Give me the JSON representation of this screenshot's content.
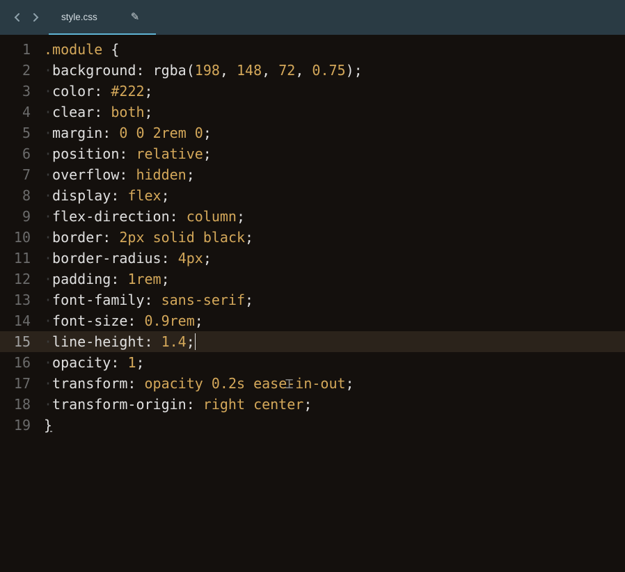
{
  "tab": {
    "filename": "style.css",
    "modified_glyph": "✎"
  },
  "editor": {
    "active_line": 15,
    "text_cursor_line": 17,
    "lines": [
      {
        "n": 1,
        "tokens": [
          {
            "cls": "sel",
            "t": ".module"
          },
          {
            "cls": "brace",
            "t": " {"
          }
        ],
        "indent": 0
      },
      {
        "n": 2,
        "tokens": [
          {
            "cls": "prop",
            "t": "background"
          },
          {
            "cls": "colon",
            "t": ": "
          },
          {
            "cls": "func",
            "t": "rgba("
          },
          {
            "cls": "num",
            "t": "198"
          },
          {
            "cls": "comma",
            "t": ", "
          },
          {
            "cls": "num",
            "t": "148"
          },
          {
            "cls": "comma",
            "t": ", "
          },
          {
            "cls": "num",
            "t": "72"
          },
          {
            "cls": "comma",
            "t": ", "
          },
          {
            "cls": "num",
            "t": "0.75"
          },
          {
            "cls": "func",
            "t": ")"
          },
          {
            "cls": "semi",
            "t": ";"
          }
        ],
        "indent": 1
      },
      {
        "n": 3,
        "tokens": [
          {
            "cls": "prop",
            "t": "color"
          },
          {
            "cls": "colon",
            "t": ": "
          },
          {
            "cls": "hex",
            "t": "#222"
          },
          {
            "cls": "semi",
            "t": ";"
          }
        ],
        "indent": 1
      },
      {
        "n": 4,
        "tokens": [
          {
            "cls": "prop",
            "t": "clear"
          },
          {
            "cls": "colon",
            "t": ": "
          },
          {
            "cls": "kw",
            "t": "both"
          },
          {
            "cls": "semi",
            "t": ";"
          }
        ],
        "indent": 1
      },
      {
        "n": 5,
        "tokens": [
          {
            "cls": "prop",
            "t": "margin"
          },
          {
            "cls": "colon",
            "t": ": "
          },
          {
            "cls": "num",
            "t": "0"
          },
          {
            "cls": "ws",
            "t": " "
          },
          {
            "cls": "num",
            "t": "0"
          },
          {
            "cls": "ws",
            "t": " "
          },
          {
            "cls": "num",
            "t": "2rem"
          },
          {
            "cls": "ws",
            "t": " "
          },
          {
            "cls": "num",
            "t": "0"
          },
          {
            "cls": "semi",
            "t": ";"
          }
        ],
        "indent": 1
      },
      {
        "n": 6,
        "tokens": [
          {
            "cls": "prop",
            "t": "position"
          },
          {
            "cls": "colon",
            "t": ": "
          },
          {
            "cls": "kw",
            "t": "relative"
          },
          {
            "cls": "semi",
            "t": ";"
          }
        ],
        "indent": 1
      },
      {
        "n": 7,
        "tokens": [
          {
            "cls": "prop",
            "t": "overflow"
          },
          {
            "cls": "colon",
            "t": ": "
          },
          {
            "cls": "kw",
            "t": "hidden"
          },
          {
            "cls": "semi",
            "t": ";"
          }
        ],
        "indent": 1
      },
      {
        "n": 8,
        "tokens": [
          {
            "cls": "prop",
            "t": "display"
          },
          {
            "cls": "colon",
            "t": ": "
          },
          {
            "cls": "kw",
            "t": "flex"
          },
          {
            "cls": "semi",
            "t": ";"
          }
        ],
        "indent": 1
      },
      {
        "n": 9,
        "tokens": [
          {
            "cls": "prop",
            "t": "flex-direction"
          },
          {
            "cls": "colon",
            "t": ": "
          },
          {
            "cls": "kw",
            "t": "column"
          },
          {
            "cls": "semi",
            "t": ";"
          }
        ],
        "indent": 1
      },
      {
        "n": 10,
        "tokens": [
          {
            "cls": "prop",
            "t": "border"
          },
          {
            "cls": "colon",
            "t": ": "
          },
          {
            "cls": "num",
            "t": "2px"
          },
          {
            "cls": "ws",
            "t": " "
          },
          {
            "cls": "kw",
            "t": "solid"
          },
          {
            "cls": "ws",
            "t": " "
          },
          {
            "cls": "kw",
            "t": "black"
          },
          {
            "cls": "semi",
            "t": ";"
          }
        ],
        "indent": 1
      },
      {
        "n": 11,
        "tokens": [
          {
            "cls": "prop",
            "t": "border-radius"
          },
          {
            "cls": "colon",
            "t": ": "
          },
          {
            "cls": "num",
            "t": "4px"
          },
          {
            "cls": "semi",
            "t": ";"
          }
        ],
        "indent": 1
      },
      {
        "n": 12,
        "tokens": [
          {
            "cls": "prop",
            "t": "padding"
          },
          {
            "cls": "colon",
            "t": ": "
          },
          {
            "cls": "num",
            "t": "1rem"
          },
          {
            "cls": "semi",
            "t": ";"
          }
        ],
        "indent": 1
      },
      {
        "n": 13,
        "tokens": [
          {
            "cls": "prop",
            "t": "font-family"
          },
          {
            "cls": "colon",
            "t": ": "
          },
          {
            "cls": "kw",
            "t": "sans-serif"
          },
          {
            "cls": "semi",
            "t": ";"
          }
        ],
        "indent": 1
      },
      {
        "n": 14,
        "tokens": [
          {
            "cls": "prop",
            "t": "font-size"
          },
          {
            "cls": "colon",
            "t": ": "
          },
          {
            "cls": "num",
            "t": "0.9rem"
          },
          {
            "cls": "semi",
            "t": ";"
          }
        ],
        "indent": 1
      },
      {
        "n": 15,
        "tokens": [
          {
            "cls": "prop",
            "t": "line-height"
          },
          {
            "cls": "colon",
            "t": ": "
          },
          {
            "cls": "num",
            "t": "1.4"
          },
          {
            "cls": "semi",
            "t": ";"
          }
        ],
        "indent": 1,
        "caret_after": true
      },
      {
        "n": 16,
        "tokens": [
          {
            "cls": "prop",
            "t": "opacity"
          },
          {
            "cls": "colon",
            "t": ": "
          },
          {
            "cls": "num",
            "t": "1"
          },
          {
            "cls": "semi",
            "t": ";"
          }
        ],
        "indent": 1
      },
      {
        "n": 17,
        "tokens": [
          {
            "cls": "prop",
            "t": "transform"
          },
          {
            "cls": "colon",
            "t": ": "
          },
          {
            "cls": "kw",
            "t": "opacity"
          },
          {
            "cls": "ws",
            "t": " "
          },
          {
            "cls": "num",
            "t": "0.2s"
          },
          {
            "cls": "ws",
            "t": " "
          },
          {
            "cls": "kw",
            "t": "ease-in-out"
          },
          {
            "cls": "semi",
            "t": ";"
          }
        ],
        "indent": 1
      },
      {
        "n": 18,
        "tokens": [
          {
            "cls": "prop",
            "t": "transform-origin"
          },
          {
            "cls": "colon",
            "t": ": "
          },
          {
            "cls": "kw",
            "t": "right"
          },
          {
            "cls": "ws",
            "t": " "
          },
          {
            "cls": "kw",
            "t": "center"
          },
          {
            "cls": "semi",
            "t": ";"
          }
        ],
        "indent": 1
      },
      {
        "n": 19,
        "tokens": [
          {
            "cls": "brace underline-last",
            "t": "}"
          }
        ],
        "indent": 0
      }
    ]
  }
}
